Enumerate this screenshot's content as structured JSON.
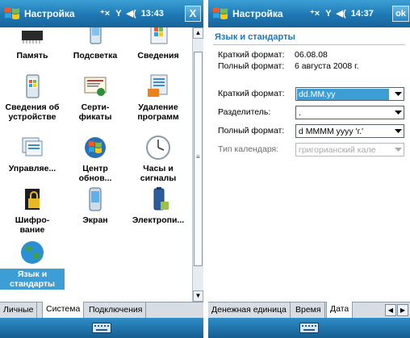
{
  "left": {
    "titlebar": {
      "title": "Настройка",
      "time": "13:43",
      "close_label": "X"
    },
    "items": [
      {
        "label": "Память",
        "icon": "memory-chip-icon"
      },
      {
        "label": "Подсветка",
        "icon": "backlight-phone-icon"
      },
      {
        "label": "Сведения",
        "icon": "windows-info-icon"
      },
      {
        "label": "Сведения об\nустройстве",
        "icon": "device-info-icon"
      },
      {
        "label": "Серти-\nфикаты",
        "icon": "certificate-icon"
      },
      {
        "label": "Удаление\nпрограмм",
        "icon": "remove-programs-icon"
      },
      {
        "label": "Управляе...",
        "icon": "manage-icon"
      },
      {
        "label": "Центр\nобнов...",
        "icon": "update-center-icon"
      },
      {
        "label": "Часы и\nсигналы",
        "icon": "clock-icon"
      },
      {
        "label": "Шифро-\nвание",
        "icon": "encryption-card-icon"
      },
      {
        "label": "Экран",
        "icon": "screen-icon"
      },
      {
        "label": "Электропи...",
        "icon": "battery-icon"
      },
      {
        "label": "Язык и\nстандарты",
        "icon": "globe-icon"
      }
    ],
    "tabs": [
      "Личные",
      "Система",
      "Подключения"
    ],
    "active_tab": "Система"
  },
  "right": {
    "titlebar": {
      "title": "Настройка",
      "time": "14:37",
      "ok_label": "ok"
    },
    "section_title": "Язык и стандарты",
    "info": [
      {
        "key": "Краткий формат:",
        "value": "06.08.08"
      },
      {
        "key": "Полный формат:",
        "value": "6 августа 2008 г."
      }
    ],
    "fields": [
      {
        "label": "Краткий формат:",
        "value": "dd.MM.yy"
      },
      {
        "label": "Разделитель:",
        "value": "."
      },
      {
        "label": "Полный формат:",
        "value": "d MMMM yyyy 'г.'"
      },
      {
        "label": "Тип календаря:",
        "value": "григорианский кале"
      }
    ],
    "tabs": [
      "Денежная единица",
      "Время",
      "Дата"
    ],
    "active_tab": "Дата"
  },
  "colors": {
    "accent": "#1f78b4",
    "selection": "#3d9ed6",
    "titlebar": "#1f78b4"
  }
}
